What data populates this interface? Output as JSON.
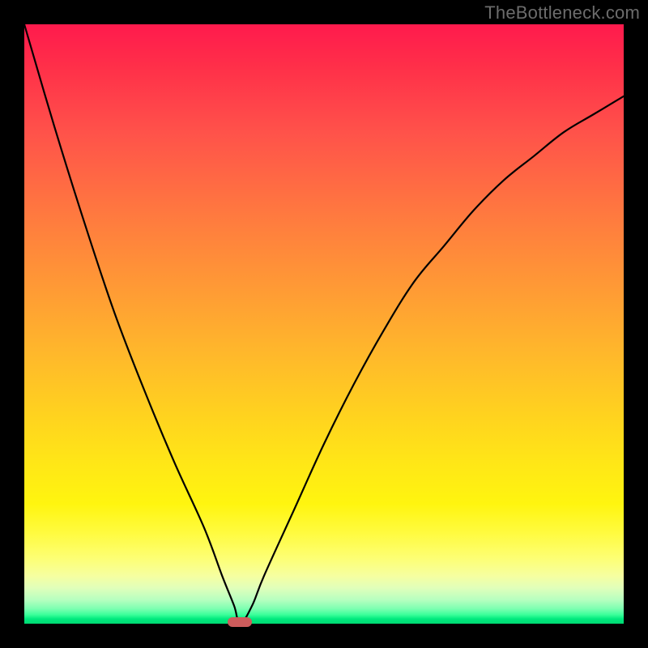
{
  "watermark": "TheBottleneck.com",
  "colors": {
    "frame": "#000000",
    "gradient_top": "#ff1a4d",
    "gradient_mid": "#ffe617",
    "gradient_bottom": "#00d972",
    "curve": "#000000",
    "marker": "#cd5c5c",
    "watermark_text": "#6c6c6c"
  },
  "chart_data": {
    "type": "line",
    "title": "",
    "xlabel": "",
    "ylabel": "",
    "xlim": [
      0,
      100
    ],
    "ylim": [
      0,
      100
    ],
    "grid": false,
    "legend": false,
    "series": [
      {
        "name": "bottleneck-curve",
        "x": [
          0,
          5,
          10,
          15,
          20,
          25,
          30,
          33,
          35,
          36,
          38,
          40,
          45,
          50,
          55,
          60,
          65,
          70,
          75,
          80,
          85,
          90,
          95,
          100
        ],
        "y": [
          100,
          83,
          67,
          52,
          39,
          27,
          16,
          8,
          3,
          0,
          3,
          8,
          19,
          30,
          40,
          49,
          57,
          63,
          69,
          74,
          78,
          82,
          85,
          88
        ]
      }
    ],
    "annotations": [
      {
        "name": "min-marker",
        "x": 36,
        "y": 0,
        "shape": "rounded-bar"
      }
    ],
    "background_gradient": {
      "orientation": "vertical",
      "stops": [
        {
          "pct": 0,
          "color": "#ff1a4d"
        },
        {
          "pct": 50,
          "color": "#ffb82b"
        },
        {
          "pct": 80,
          "color": "#fff50f"
        },
        {
          "pct": 100,
          "color": "#00d972"
        }
      ]
    }
  }
}
